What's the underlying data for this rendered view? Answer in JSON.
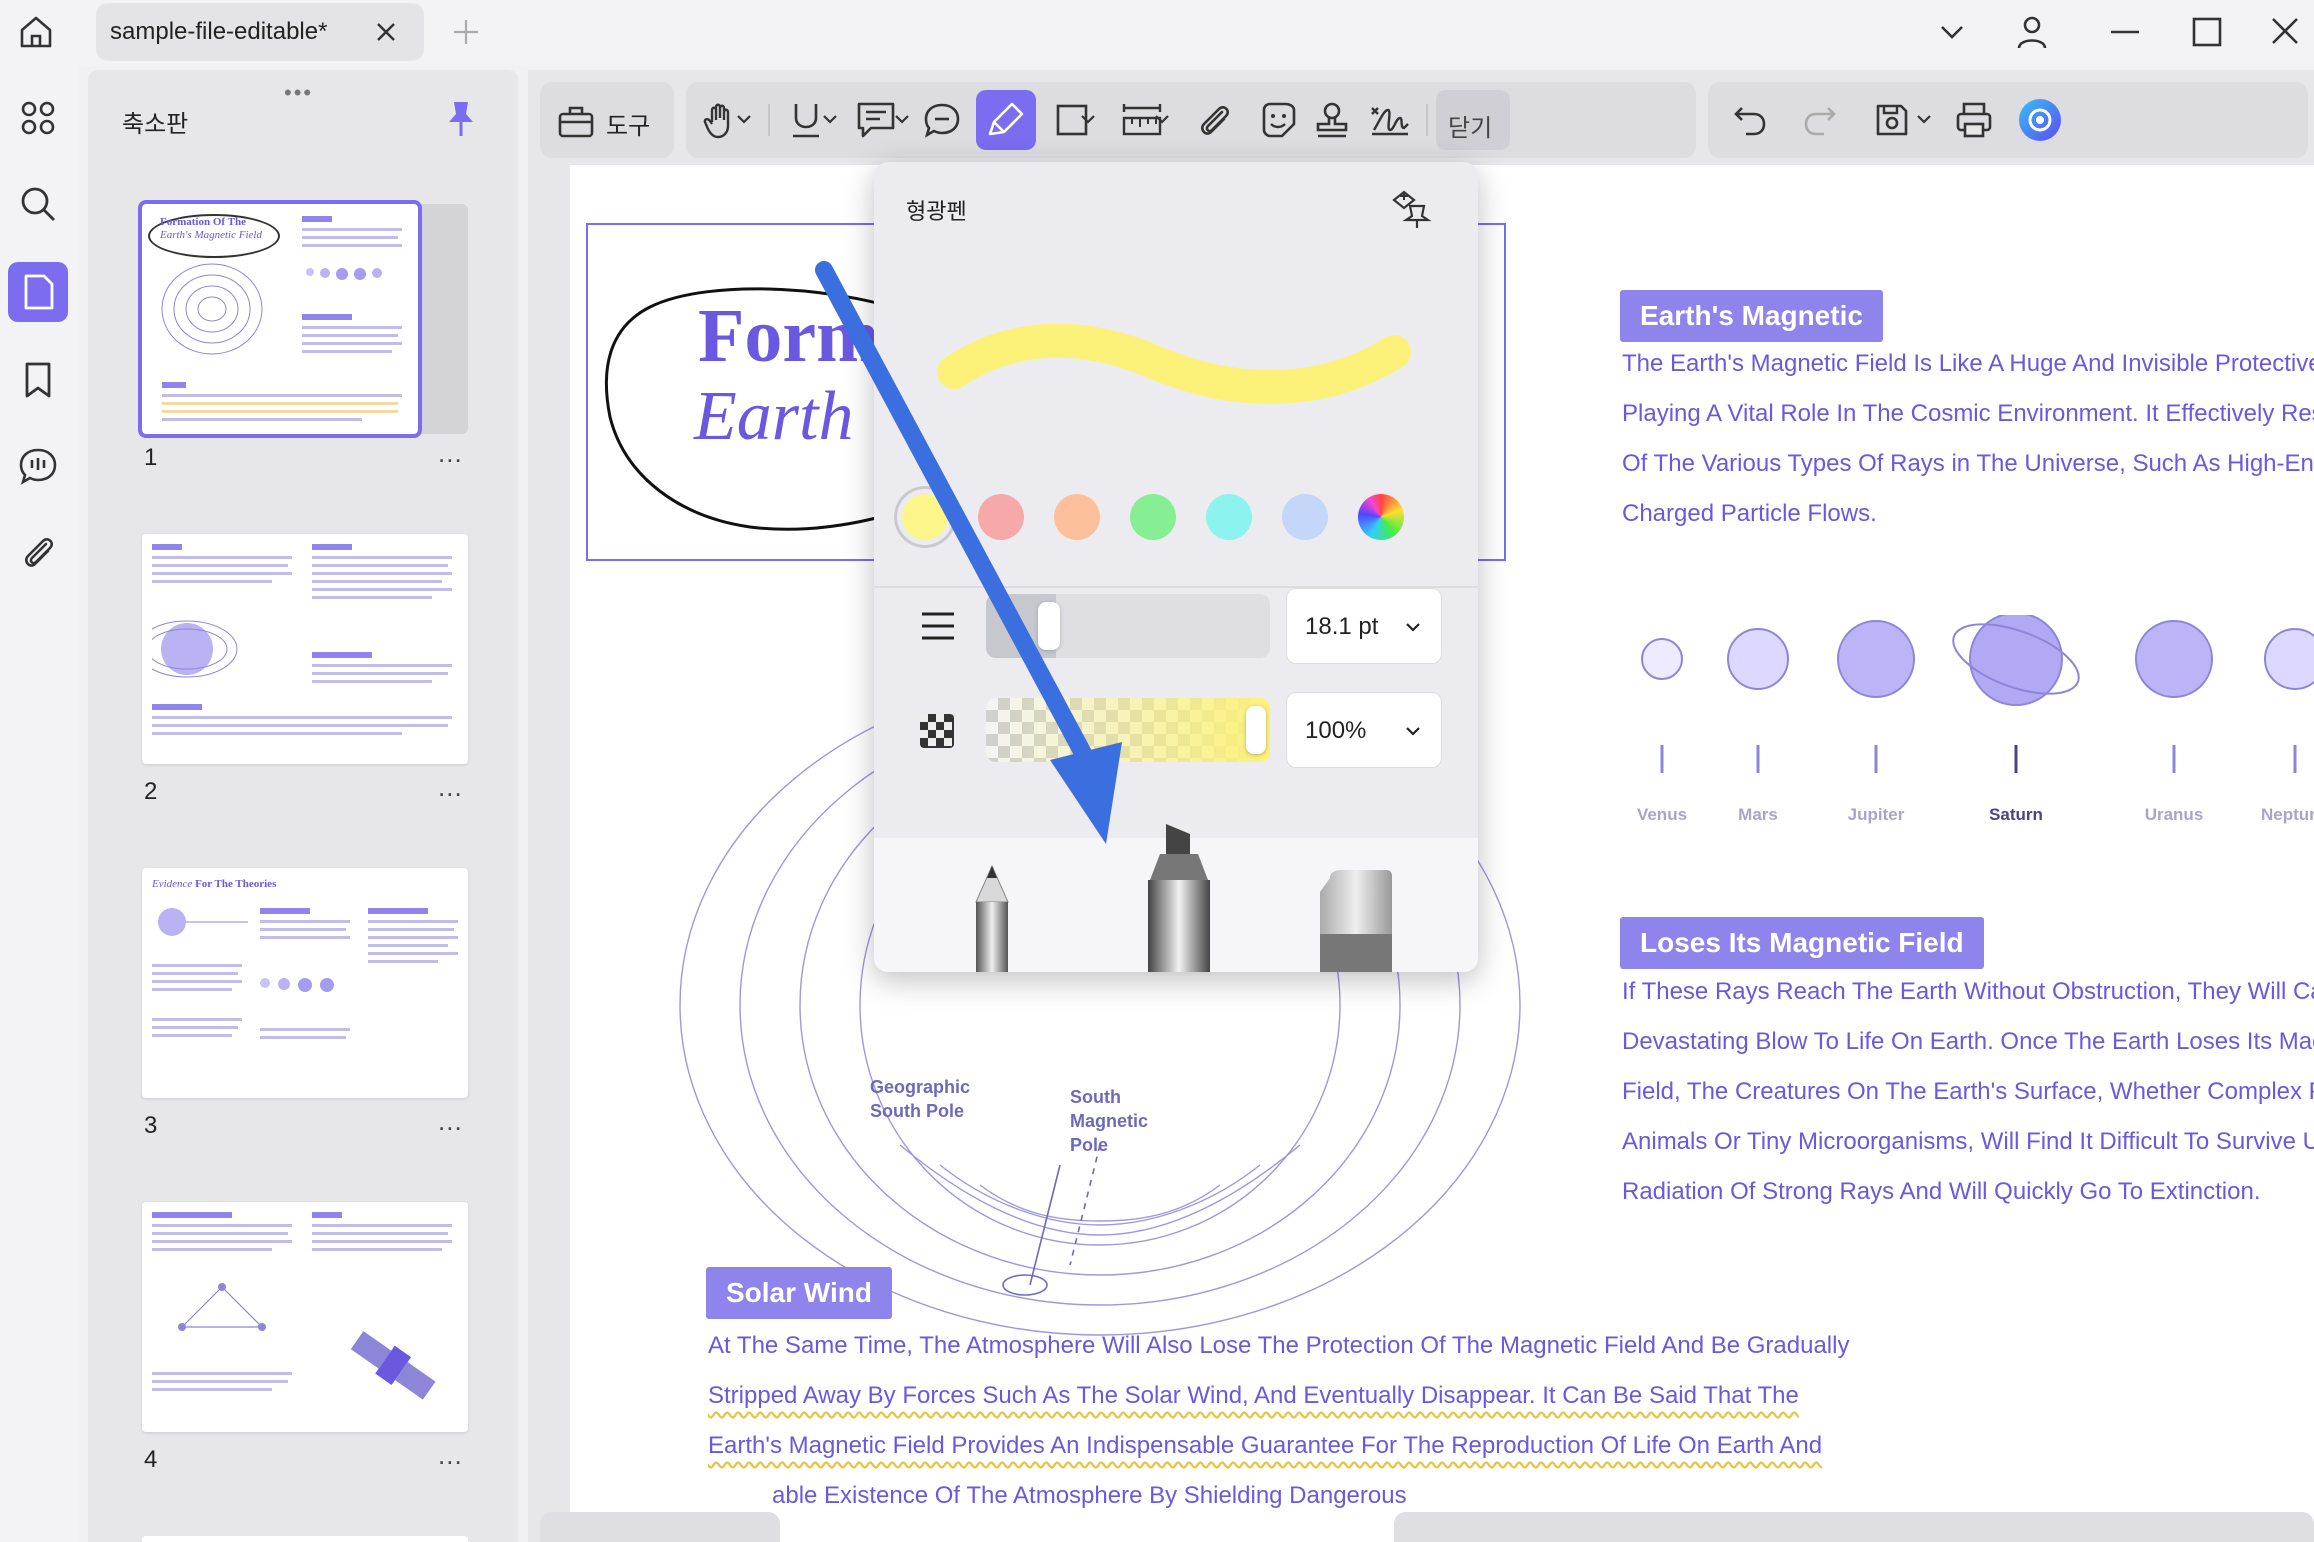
{
  "window": {
    "tab_title": "sample-file-editable*",
    "icons": {
      "home": "home-icon",
      "new_tab": "plus-icon",
      "dropdown": "chevron-down-icon",
      "account": "user-icon",
      "minimize": "minimize-icon",
      "maximize": "maximize-icon",
      "close": "close-icon"
    }
  },
  "rail": {
    "items": [
      "thumbnails-icon",
      "search-icon",
      "pages-icon",
      "bookmark-icon",
      "comment-icon",
      "attachment-icon"
    ],
    "active": "pages-icon"
  },
  "panel": {
    "title": "축소판",
    "thumbnails": [
      {
        "number": "1",
        "more": "..."
      },
      {
        "number": "2",
        "more": "..."
      },
      {
        "number": "3",
        "more": "..."
      },
      {
        "number": "4",
        "more": "..."
      }
    ]
  },
  "toolbar": {
    "tools_label": "도구",
    "close_label": "닫기"
  },
  "popup": {
    "title": "형광펜",
    "swatches": [
      "#fbf58a",
      "#f7a9a9",
      "#fbc09a",
      "#86ee93",
      "#8cf3ee",
      "#c5d6fb",
      "rainbow"
    ],
    "selected_swatch": "#fbf58a",
    "stroke_color": "#fcf27a",
    "thickness": "18.1 pt",
    "opacity": "100%"
  },
  "document": {
    "thumb_preview_title_1": "Formation Of The",
    "thumb_preview_title_2": "Earth's Magnetic Field",
    "title_fragment_1": "Form",
    "title_fragment_2": "Earth",
    "heading_magnetic": "Earth's Magnetic",
    "para_magnetic": [
      "The Earth's Magnetic Field Is Like A Huge And Invisible Protective S",
      "Playing A Vital Role In The Cosmic Environment. It Effectively Resi",
      "Of The Various Types Of Rays in The Universe, Such As High-Ene",
      "Charged Particle Flows."
    ],
    "planets": [
      "Venus",
      "Mars",
      "Jupiter",
      "Saturn",
      "Uranus",
      "Neptune"
    ],
    "heading_loses": "Loses Its Magnetic Field",
    "para_loses": [
      "If These Rays Reach The Earth Without Obstruction, They Will Cau",
      "Devastating Blow To Life On Earth. Once The Earth Loses Its Magn",
      "Field, The Creatures On The Earth's Surface, Whether Complex Pla",
      "Animals Or Tiny Microorganisms, Will Find It Difficult To Survive Ur",
      "Radiation Of Strong Rays And Will Quickly Go To Extinction."
    ],
    "pole_geo_1": "Geographic",
    "pole_geo_2": "South Pole",
    "pole_mag_1": "South",
    "pole_mag_2": "Magnetic",
    "pole_mag_3": "Pole",
    "heading_solar": "Solar Wind",
    "para_solar": [
      "At The Same Time, The Atmosphere Will Also Lose The Protection Of The Magnetic Field And Be Gradually",
      "Stripped Away By Forces Such As The Solar Wind, And Eventually Disappear. It Can Be Said That The",
      "Earth's Magnetic Field Provides An Indispensable Guarantee For The Reproduction Of Life On Earth And",
      "able Existence Of The Atmosphere By Shielding Dangerous"
    ],
    "accent_color": "#7b6cf0",
    "annotation_arrow_color": "#3b6fe0"
  }
}
